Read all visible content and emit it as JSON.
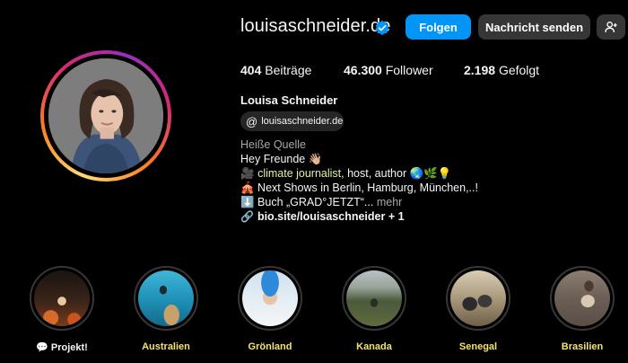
{
  "profile": {
    "username": "louisaschneider.de",
    "verified_icon": "verified-badge-icon",
    "follow_label": "Folgen",
    "message_label": "Nachricht senden",
    "adduser_icon": "add-user-icon",
    "stats": {
      "posts_count": "404",
      "posts_label": "Beiträge",
      "followers_count": "46.300",
      "followers_label": "Follower",
      "following_count": "2.198",
      "following_label": "Gefolgt"
    },
    "full_name": "Louisa Schneider",
    "threads_handle": "louisaschneider.de",
    "category": "Heiße Quelle",
    "bio": {
      "line1": "Hey Freunde 👋🏼",
      "line2_icon": "🎥",
      "line2_highlight": "climate journalist",
      "line2_rest": ", host, author 🌏🌿💡",
      "line3": "🎪 Next Shows in Berlin, Hamburg, München,..!",
      "line4_main": "⬇️ Buch „GRAD°JETZT“...",
      "line4_more": " mehr",
      "line5_link": "bio.site/louisaschneider + 1"
    }
  },
  "highlights": [
    {
      "label": "💬 Projekt!"
    },
    {
      "label": "Australien"
    },
    {
      "label": "Grönland"
    },
    {
      "label": "Kanada"
    },
    {
      "label": "Senegal"
    },
    {
      "label": "Brasilien"
    }
  ],
  "colors": {
    "accent_blue": "#0095f6",
    "button_gray": "#363636",
    "highlight_label_yellow": "#f7e36a"
  }
}
